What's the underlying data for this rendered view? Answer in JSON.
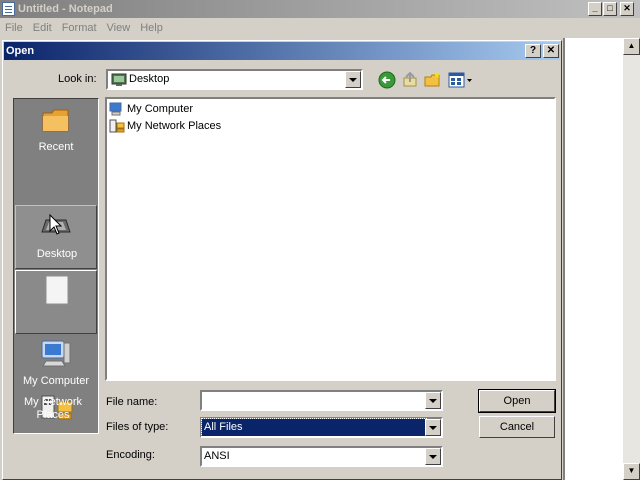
{
  "notepad": {
    "title": "Untitled - Notepad",
    "menu": [
      "File",
      "Edit",
      "Format",
      "View",
      "Help"
    ],
    "window_buttons": {
      "minimize": "_",
      "maximize": "□",
      "close": "✕"
    }
  },
  "dialog": {
    "title": "Open",
    "help_button": "?",
    "close_button": "✕",
    "look_in": {
      "label": "Look in:",
      "value": "Desktop",
      "icon": "desktop-icon"
    },
    "toolbar": [
      "back-icon",
      "up-folder-icon",
      "new-folder-icon",
      "view-menu-icon"
    ],
    "places": [
      {
        "label": "Recent",
        "icon": "recent-folder-icon"
      },
      {
        "label": "Desktop",
        "icon": "desktop-icon"
      },
      {
        "label": "",
        "icon": "my-documents-icon"
      },
      {
        "label": "My Computer",
        "icon": "my-computer-icon"
      },
      {
        "label": "My Network Places",
        "icon": "network-places-icon"
      }
    ],
    "files": [
      {
        "name": "My Computer",
        "icon": "my-computer-icon"
      },
      {
        "name": "My Network Places",
        "icon": "network-places-icon"
      }
    ],
    "file_name": {
      "label": "File name:",
      "value": ""
    },
    "file_type": {
      "label": "Files of type:",
      "value": "All Files"
    },
    "encoding": {
      "label": "Encoding:",
      "value": "ANSI"
    },
    "buttons": {
      "open": "Open",
      "cancel": "Cancel"
    }
  },
  "colors": {
    "title_active_start": "#0a246a",
    "title_active_end": "#a6caf0",
    "selection": "#0a246a",
    "face": "#d4d0c8"
  }
}
